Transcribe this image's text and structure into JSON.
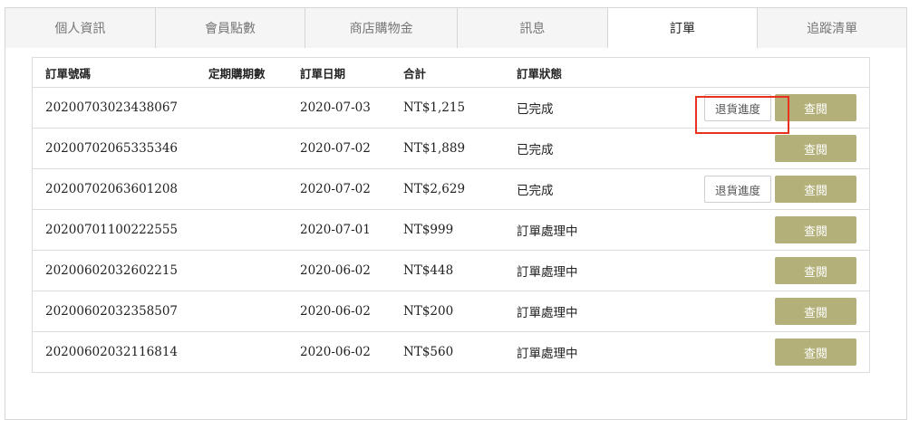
{
  "tabs": [
    {
      "label": "個人資訊"
    },
    {
      "label": "會員點數"
    },
    {
      "label": "商店購物金"
    },
    {
      "label": "訊息"
    },
    {
      "label": "訂單"
    },
    {
      "label": "追蹤清單"
    }
  ],
  "active_tab": "訂單",
  "table": {
    "headers": {
      "order_no": "訂單號碼",
      "subscription_period": "定期購期數",
      "order_date": "訂單日期",
      "total": "合計",
      "status": "訂單狀態"
    },
    "view_label": "查閱",
    "return_label": "退貨進度",
    "rows": [
      {
        "order_no": "20200703023438067",
        "subscription_period": "",
        "order_date": "2020-07-03",
        "total": "NT$1,215",
        "status": "已完成"
      },
      {
        "order_no": "20200702065335346",
        "subscription_period": "",
        "order_date": "2020-07-02",
        "total": "NT$1,889",
        "status": "已完成"
      },
      {
        "order_no": "20200702063601208",
        "subscription_period": "",
        "order_date": "2020-07-02",
        "total": "NT$2,629",
        "status": "已完成"
      },
      {
        "order_no": "20200701100222555",
        "subscription_period": "",
        "order_date": "2020-07-01",
        "total": "NT$999",
        "status": "訂單處理中"
      },
      {
        "order_no": "20200602032602215",
        "subscription_period": "",
        "order_date": "2020-06-02",
        "total": "NT$448",
        "status": "訂單處理中"
      },
      {
        "order_no": "20200602032358507",
        "subscription_period": "",
        "order_date": "2020-06-02",
        "total": "NT$200",
        "status": "訂單處理中"
      },
      {
        "order_no": "20200602032116814",
        "subscription_period": "",
        "order_date": "2020-06-02",
        "total": "NT$560",
        "status": "訂單處理中"
      }
    ]
  },
  "colors": {
    "view_button": "#b3b07a",
    "highlight_box": "#e8321e"
  }
}
